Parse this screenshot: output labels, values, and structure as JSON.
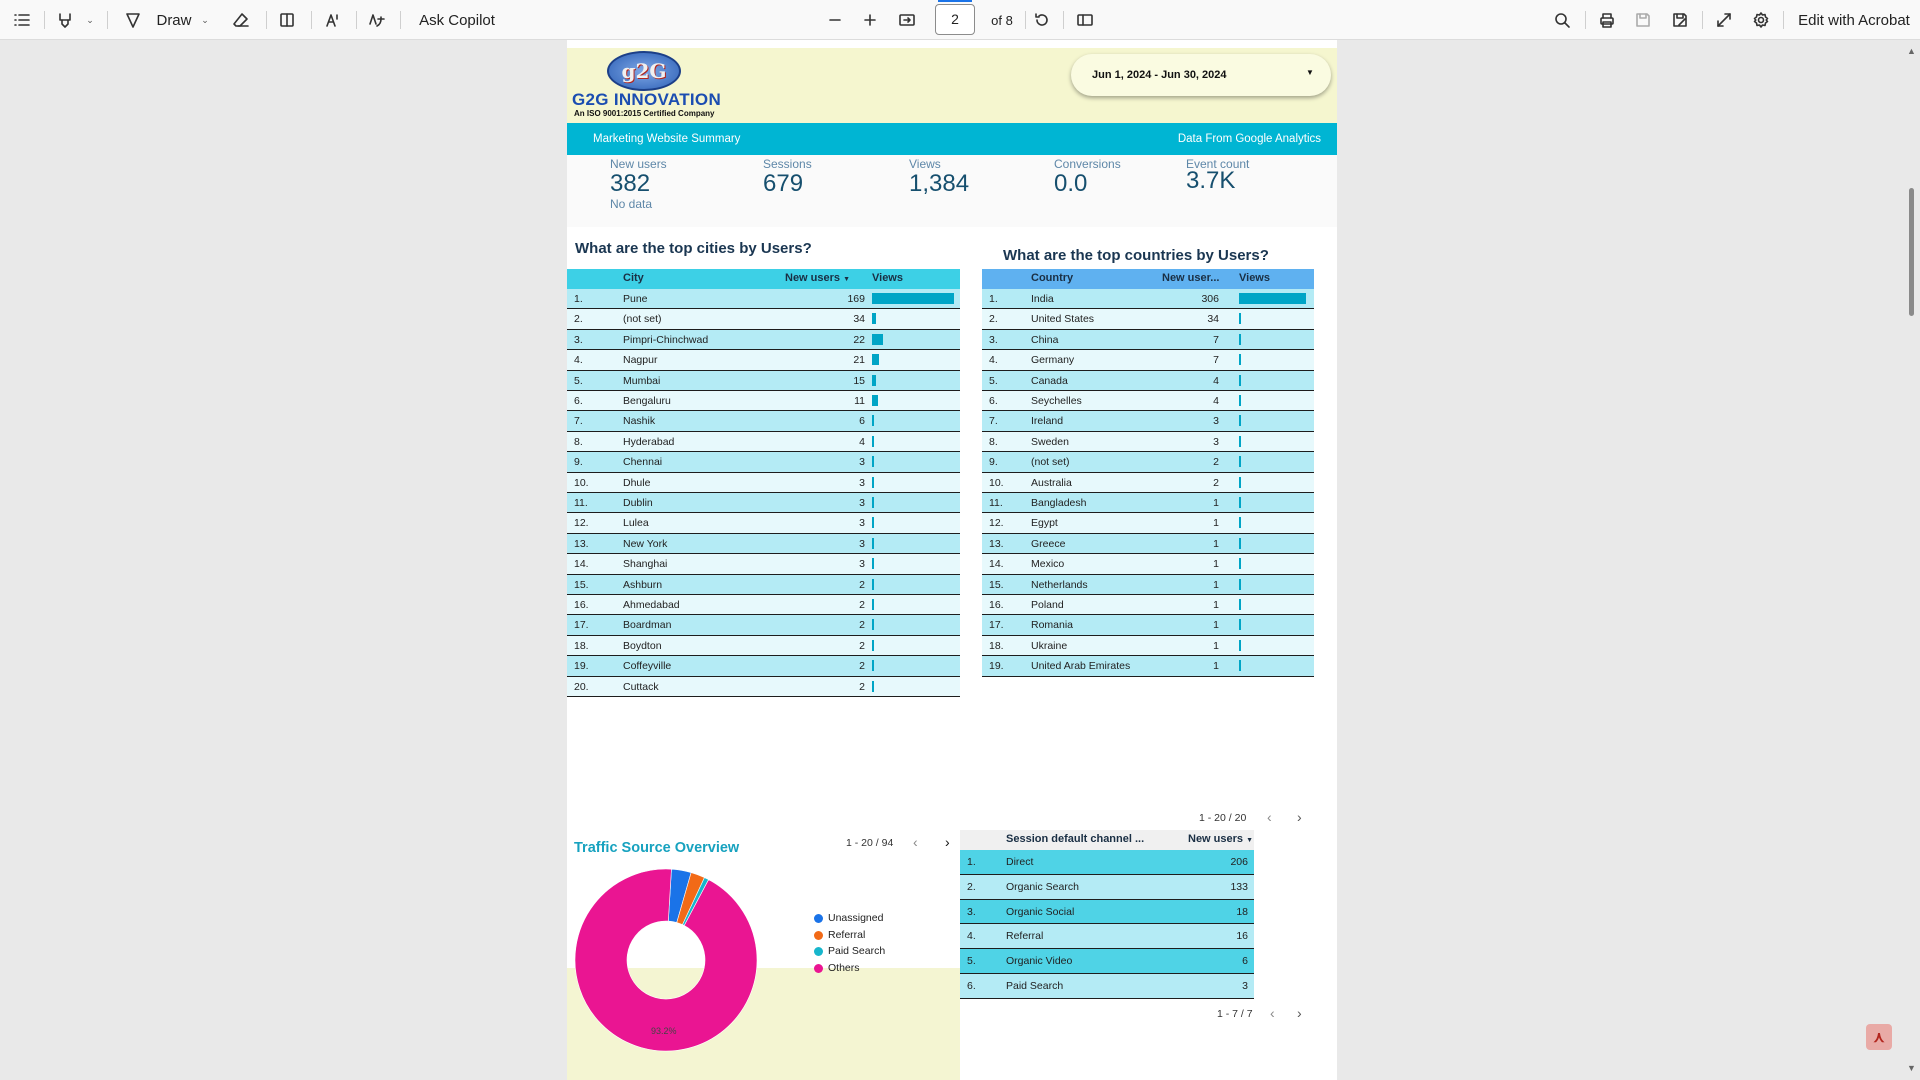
{
  "toolbar": {
    "draw_label": "Draw",
    "ask_copilot_label": "Ask Copilot",
    "page_current": "2",
    "page_total": "of 8",
    "edit_acrobat_label": "Edit with Acrobat"
  },
  "header": {
    "logo_mark": "g2G",
    "logo_name": "G2G INNOVATION",
    "logo_tagline": "An ISO 9001:2015 Certified Company",
    "date_range": "Jun 1, 2024 - Jun 30, 2024",
    "banner_left": "Marketing Website Summary",
    "banner_right": "Data From Google Analytics"
  },
  "kpis": [
    {
      "label": "New users",
      "value": "382",
      "sub": "No data"
    },
    {
      "label": "Sessions",
      "value": "679",
      "sub": ""
    },
    {
      "label": "Views",
      "value": "1,384",
      "sub": ""
    },
    {
      "label": "Conversions",
      "value": "0.0",
      "sub": ""
    },
    {
      "label": "Event count",
      "value": "3.7K",
      "sub": ""
    }
  ],
  "cities": {
    "title": "What are the top cities by Users?",
    "col_city": "City",
    "col_new_users": "New users",
    "col_views": "Views",
    "pager": "1 - 20 / 94",
    "rows": [
      {
        "rank": "1.",
        "name": "Pune",
        "users": "169",
        "views": 1.0
      },
      {
        "rank": "2.",
        "name": "(not set)",
        "users": "34",
        "views": 0.05
      },
      {
        "rank": "3.",
        "name": "Pimpri-Chinchwad",
        "users": "22",
        "views": 0.14
      },
      {
        "rank": "4.",
        "name": "Nagpur",
        "users": "21",
        "views": 0.09
      },
      {
        "rank": "5.",
        "name": "Mumbai",
        "users": "15",
        "views": 0.05
      },
      {
        "rank": "6.",
        "name": "Bengaluru",
        "users": "11",
        "views": 0.07
      },
      {
        "rank": "7.",
        "name": "Nashik",
        "users": "6",
        "views": 0.03
      },
      {
        "rank": "8.",
        "name": "Hyderabad",
        "users": "4",
        "views": 0.015
      },
      {
        "rank": "9.",
        "name": "Chennai",
        "users": "3",
        "views": 0.03
      },
      {
        "rank": "10.",
        "name": "Dhule",
        "users": "3",
        "views": 0.015
      },
      {
        "rank": "11.",
        "name": "Dublin",
        "users": "3",
        "views": 0.03
      },
      {
        "rank": "12.",
        "name": "Lulea",
        "users": "3",
        "views": 0.015
      },
      {
        "rank": "13.",
        "name": "New York",
        "users": "3",
        "views": 0.015
      },
      {
        "rank": "14.",
        "name": "Shanghai",
        "users": "3",
        "views": 0.015
      },
      {
        "rank": "15.",
        "name": "Ashburn",
        "users": "2",
        "views": 0.015
      },
      {
        "rank": "16.",
        "name": "Ahmedabad",
        "users": "2",
        "views": 0.03
      },
      {
        "rank": "17.",
        "name": "Boardman",
        "users": "2",
        "views": 0.015
      },
      {
        "rank": "18.",
        "name": "Boydton",
        "users": "2",
        "views": 0.015
      },
      {
        "rank": "19.",
        "name": "Coffeyville",
        "users": "2",
        "views": 0.015
      },
      {
        "rank": "20.",
        "name": "Cuttack",
        "users": "2",
        "views": 0.015
      }
    ]
  },
  "countries": {
    "title": "What are the top countries by Users?",
    "col_country": "Country",
    "col_new_users": "New user...",
    "col_views": "Views",
    "pager": "1 - 20 / 20",
    "rows": [
      {
        "rank": "1.",
        "name": "India",
        "users": "306",
        "views": 1.0
      },
      {
        "rank": "2.",
        "name": "United States",
        "users": "34",
        "views": 0.03
      },
      {
        "rank": "3.",
        "name": "China",
        "users": "7",
        "views": 0.015
      },
      {
        "rank": "4.",
        "name": "Germany",
        "users": "7",
        "views": 0.015
      },
      {
        "rank": "5.",
        "name": "Canada",
        "users": "4",
        "views": 0.015
      },
      {
        "rank": "6.",
        "name": "Seychelles",
        "users": "4",
        "views": 0.015
      },
      {
        "rank": "7.",
        "name": "Ireland",
        "users": "3",
        "views": 0.015
      },
      {
        "rank": "8.",
        "name": "Sweden",
        "users": "3",
        "views": 0.015
      },
      {
        "rank": "9.",
        "name": "(not set)",
        "users": "2",
        "views": 0.015
      },
      {
        "rank": "10.",
        "name": "Australia",
        "users": "2",
        "views": 0.015
      },
      {
        "rank": "11.",
        "name": "Bangladesh",
        "users": "1",
        "views": 0.015
      },
      {
        "rank": "12.",
        "name": "Egypt",
        "users": "1",
        "views": 0.015
      },
      {
        "rank": "13.",
        "name": "Greece",
        "users": "1",
        "views": 0.015
      },
      {
        "rank": "14.",
        "name": "Mexico",
        "users": "1",
        "views": 0.015
      },
      {
        "rank": "15.",
        "name": "Netherlands",
        "users": "1",
        "views": 0.015
      },
      {
        "rank": "16.",
        "name": "Poland",
        "users": "1",
        "views": 0.015
      },
      {
        "rank": "17.",
        "name": "Romania",
        "users": "1",
        "views": 0.015
      },
      {
        "rank": "18.",
        "name": "Ukraine",
        "users": "1",
        "views": 0.015
      },
      {
        "rank": "19.",
        "name": "United Arab Emirates",
        "users": "1",
        "views": 0.015
      }
    ]
  },
  "traffic": {
    "title": "Traffic Source Overview",
    "legend": [
      {
        "name": "Unassigned",
        "color": "#1a73e8"
      },
      {
        "name": "Referral",
        "color": "#f26a17"
      },
      {
        "name": "Paid Search",
        "color": "#17b6cc"
      },
      {
        "name": "Others",
        "color": "#ea1592"
      }
    ],
    "slices": [
      {
        "name": "Unassigned",
        "value": 3.5,
        "color": "#1a73e8"
      },
      {
        "name": "Referral",
        "value": 2.5,
        "color": "#f26a17"
      },
      {
        "name": "Paid Search",
        "value": 0.8,
        "color": "#17b6cc"
      },
      {
        "name": "Others",
        "value": 93.2,
        "color": "#ea1592"
      }
    ],
    "others_pct": "93.2%"
  },
  "channels": {
    "col_channel": "Session default channel ...",
    "col_new_users": "New users",
    "pager": "1 - 7 / 7",
    "rows": [
      {
        "rank": "1.",
        "name": "Direct",
        "users": "206"
      },
      {
        "rank": "2.",
        "name": "Organic Search",
        "users": "133"
      },
      {
        "rank": "3.",
        "name": "Organic Social",
        "users": "18"
      },
      {
        "rank": "4.",
        "name": "Referral",
        "users": "16"
      },
      {
        "rank": "5.",
        "name": "Organic Video",
        "users": "6"
      },
      {
        "rank": "6.",
        "name": "Paid Search",
        "users": "3"
      }
    ]
  }
}
